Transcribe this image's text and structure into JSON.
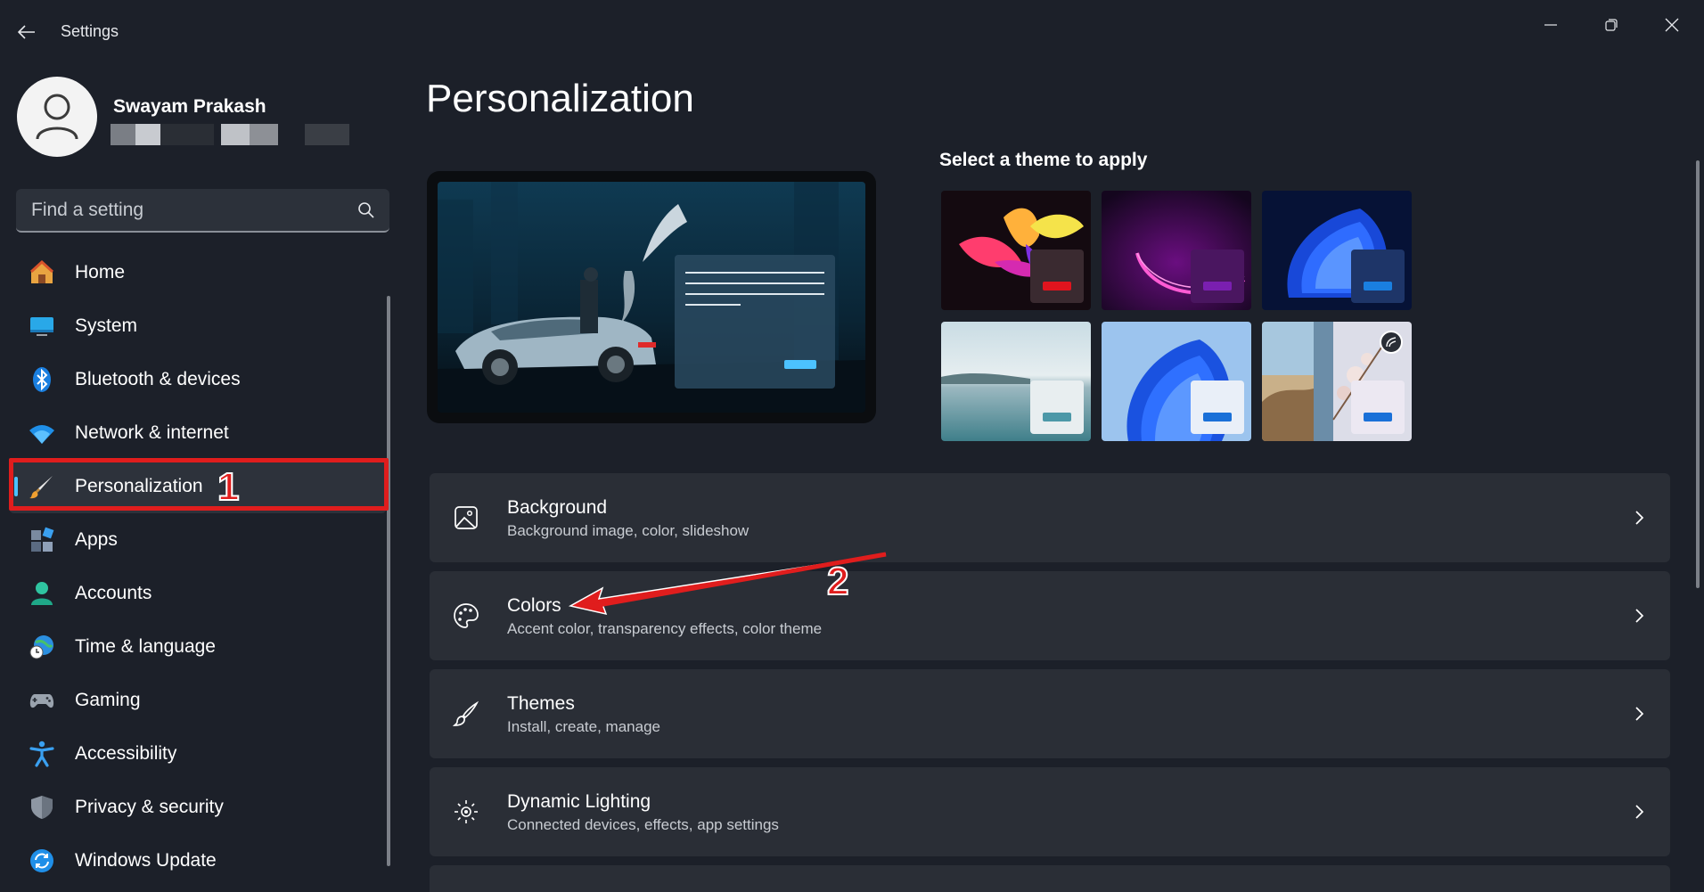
{
  "window": {
    "title": "Settings"
  },
  "profile": {
    "name": "Swayam Prakash"
  },
  "search": {
    "placeholder": "Find a setting"
  },
  "nav": {
    "items": [
      {
        "label": "Home",
        "icon": "home-icon"
      },
      {
        "label": "System",
        "icon": "monitor-icon"
      },
      {
        "label": "Bluetooth & devices",
        "icon": "bluetooth-icon"
      },
      {
        "label": "Network & internet",
        "icon": "wifi-icon"
      },
      {
        "label": "Personalization",
        "icon": "paintbrush-icon",
        "active": true
      },
      {
        "label": "Apps",
        "icon": "apps-icon"
      },
      {
        "label": "Accounts",
        "icon": "person-icon"
      },
      {
        "label": "Time & language",
        "icon": "globe-clock-icon"
      },
      {
        "label": "Gaming",
        "icon": "gamepad-icon"
      },
      {
        "label": "Accessibility",
        "icon": "accessibility-icon"
      },
      {
        "label": "Privacy & security",
        "icon": "shield-icon"
      },
      {
        "label": "Windows Update",
        "icon": "update-icon"
      }
    ]
  },
  "main": {
    "title": "Personalization",
    "theme_heading": "Select a theme to apply",
    "rows": [
      {
        "title": "Background",
        "subtitle": "Background image, color, slideshow",
        "icon": "image-icon"
      },
      {
        "title": "Colors",
        "subtitle": "Accent color, transparency effects, color theme",
        "icon": "palette-icon"
      },
      {
        "title": "Themes",
        "subtitle": "Install, create, manage",
        "icon": "brush-icon"
      },
      {
        "title": "Dynamic Lighting",
        "subtitle": "Connected devices, effects, app settings",
        "icon": "sparkle-light-icon"
      }
    ]
  },
  "annotations": {
    "step1": "1",
    "step2": "2",
    "color": "#e01d1d"
  },
  "colors": {
    "accent": "#4cc2ff",
    "background": "#1c2029",
    "card": "#2a2e36"
  }
}
